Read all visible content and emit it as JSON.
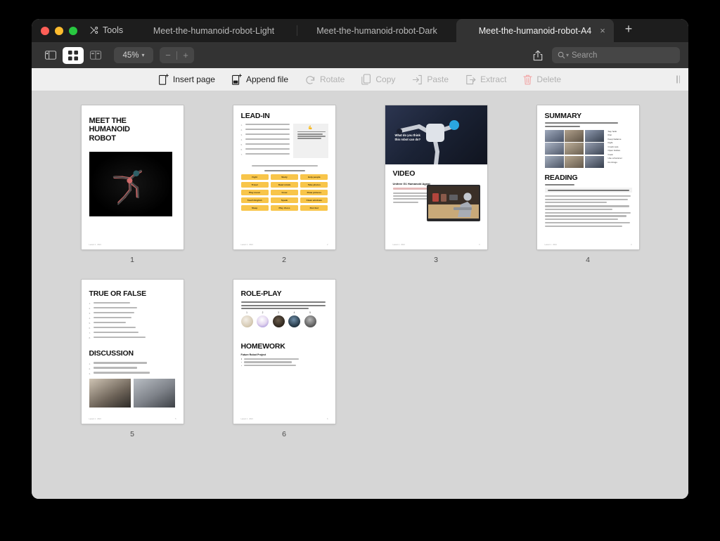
{
  "window": {
    "traffic_lights": [
      "close",
      "minimize",
      "maximize"
    ],
    "tools_label": "Tools"
  },
  "tabs": [
    {
      "title": "Meet-the-humanoid-robot-Light",
      "active": false
    },
    {
      "title": "Meet-the-humanoid-robot-Dark",
      "active": false
    },
    {
      "title": "Meet-the-humanoid-robot-A4",
      "active": true
    }
  ],
  "new_tab_label": "+",
  "close_tab_label": "×",
  "toolbar": {
    "sidebar_icon": "sidebar-icon",
    "grid_icon": "grid-view-icon",
    "page_icon": "two-page-view-icon",
    "zoom_level": "45%",
    "zoom_chevron": "⌄",
    "zoom_out_label": "−",
    "zoom_in_label": "+",
    "share_icon": "share-icon",
    "search_icon": "search-icon",
    "search_placeholder": "Search",
    "search_value": ""
  },
  "editbar": {
    "items": [
      {
        "label": "Insert page",
        "icon": "insert-page-icon",
        "enabled": true
      },
      {
        "label": "Append file",
        "icon": "append-file-icon",
        "enabled": true
      },
      {
        "label": "Rotate",
        "icon": "rotate-icon",
        "enabled": false
      },
      {
        "label": "Copy",
        "icon": "copy-icon",
        "enabled": false
      },
      {
        "label": "Paste",
        "icon": "paste-icon",
        "enabled": false
      },
      {
        "label": "Extract",
        "icon": "extract-icon",
        "enabled": false
      },
      {
        "label": "Delete",
        "icon": "trash-icon",
        "enabled": false
      }
    ],
    "grip_icon": "resize-grip-icon"
  },
  "pages": [
    {
      "number": "1"
    },
    {
      "number": "2"
    },
    {
      "number": "3"
    },
    {
      "number": "4"
    },
    {
      "number": "5"
    },
    {
      "number": "6"
    }
  ],
  "page1": {
    "title": "MEET THE\nHUMANOID\nROBOT",
    "title_l1": "MEET THE",
    "title_l2": "HUMANOID",
    "title_l3": "ROBOT",
    "image_alt": "running-humanoid-robot-photo",
    "footer_left": "Lesson 1 · 2024"
  },
  "page2": {
    "heading": "LEAD-IN",
    "questions": [
      "What is a robot?",
      "What do robots look like?",
      "Can robots help people?",
      "Do robots have hands or arms?",
      "Do robots need batteries?",
      "Can robots talk to people?",
      "Do robots go to school?"
    ],
    "callout": "A humanoid robot looks like a person and can move like one. It can do tasks like walking, running, or talking.",
    "prompt": "What can robots do, and what can't they do? Explain.",
    "subprompt": "Robots can… / Robots can't…",
    "cards": [
      "Fight",
      "Study",
      "Help people",
      "Travel",
      "Read minds",
      "Take photos",
      "Play music",
      "Grow",
      "Draw pictures",
      "Teach English",
      "Speak",
      "Clean windows",
      "Sleep",
      "Play chess",
      "Run fast"
    ],
    "footer_left": "Lesson 1 · 2024",
    "footer_right": "2"
  },
  "page3": {
    "hero_caption_l1": "What do you think",
    "hero_caption_l2": "this robot can do?",
    "heading": "VIDEO",
    "subheading": "Unitree G1 Humanoid Agent",
    "link": "https://www.youtube.com/watch?v=AbCdEfG123",
    "body": "Watch the video and write what the Unitree G1 robot can do. Then, talk about your notes with your classmates.",
    "image_alt": "laptop-showing-robot-on-bench",
    "footer_left": "Lesson 1 · 2024",
    "footer_right": "3"
  },
  "page4": {
    "heading": "SUMMARY",
    "instruction": "Look at the pictures and use the words to say what the G1 robot can do",
    "words": [
      "Say hello",
      "Run",
      "Keep balance",
      "Fight",
      "Crush nuts",
      "Open bottles",
      "Cook",
      "Use a hammer",
      "Fix things"
    ],
    "heading2": "READING",
    "instruction2": "Read and fill in the blanks",
    "wordbank": "fight  crush  keep balance  hammer  cook  open  bottles  walk  run",
    "paragraphs": [
      "The G1 robot can walk and run. It moves around easily. When it walks, it knows how to ________. It can relax and when it needs to rest.",
      "The robot can become small to fit in small places. It can use a stick to ________ obstacles that are in its way.",
      "The robot is strong and can ________ nuts. It can ________ Coca-Cola ________ without any trouble. The G1 robot can ________ meals for you. It can also use a ________ to fix things.",
      "The robot is very useful at home. It can ________ on different surfaces. It can ________ quickly if needed. The G1 robot does many jobs well."
    ],
    "footer_left": "Lesson 1 · 2024",
    "footer_right": "4"
  },
  "page5": {
    "heading": "TRUE OR FALSE",
    "statements": [
      "The G1 robot can fly.",
      "The G1 robot can talk to people.",
      "The G1 robot can walk and run.",
      "The G1 robot can cook food.",
      "The G1 robot can swim.",
      "The G1 robot can open bottles.",
      "The G1 robot can become invisible.",
      "The G1 robot can fix things with a hammer."
    ],
    "heading2": "DISCUSSION",
    "questions": [
      "What is your favorite thing about the G1 robot?",
      "How can the G1 robot help at home?",
      "What other tasks would you like the G1 robot to do?"
    ],
    "image_alt_1": "robot-hands-cooking-in-pan",
    "image_alt_2": "robot-arm-holding-pan",
    "footer_left": "Lesson 1 · 2024",
    "footer_right": "5"
  },
  "page6": {
    "heading": "ROLE-PLAY",
    "instruction": "Split into pairs. Choose a robot. One student describes the robot's features (It can walk fast, it has hands), and the other student asks questions: \"How fast can it walk?\", \"Can it fix things?\"",
    "avatar_numbers": [
      "1",
      "2",
      "3",
      "4",
      "5"
    ],
    "heading2": "HOMEWORK",
    "subheading2": "Future Robot Project",
    "bullets": [
      "Draw a picture of a robot you want in the future.",
      "Show its features and how it helps people.",
      "Present your drawing to the class and explain it."
    ],
    "footer_left": "Lesson 1 · 2024",
    "footer_right": "6"
  },
  "colors": {
    "titlebar": "#1d1d1d",
    "toolbar": "#333333",
    "editbar": "#efefef",
    "canvas": "#d6d6d6",
    "accent_yellow": "#f8c54a",
    "traffic_red": "#ff5f57",
    "traffic_yellow": "#febc2e",
    "traffic_green": "#28c840"
  }
}
